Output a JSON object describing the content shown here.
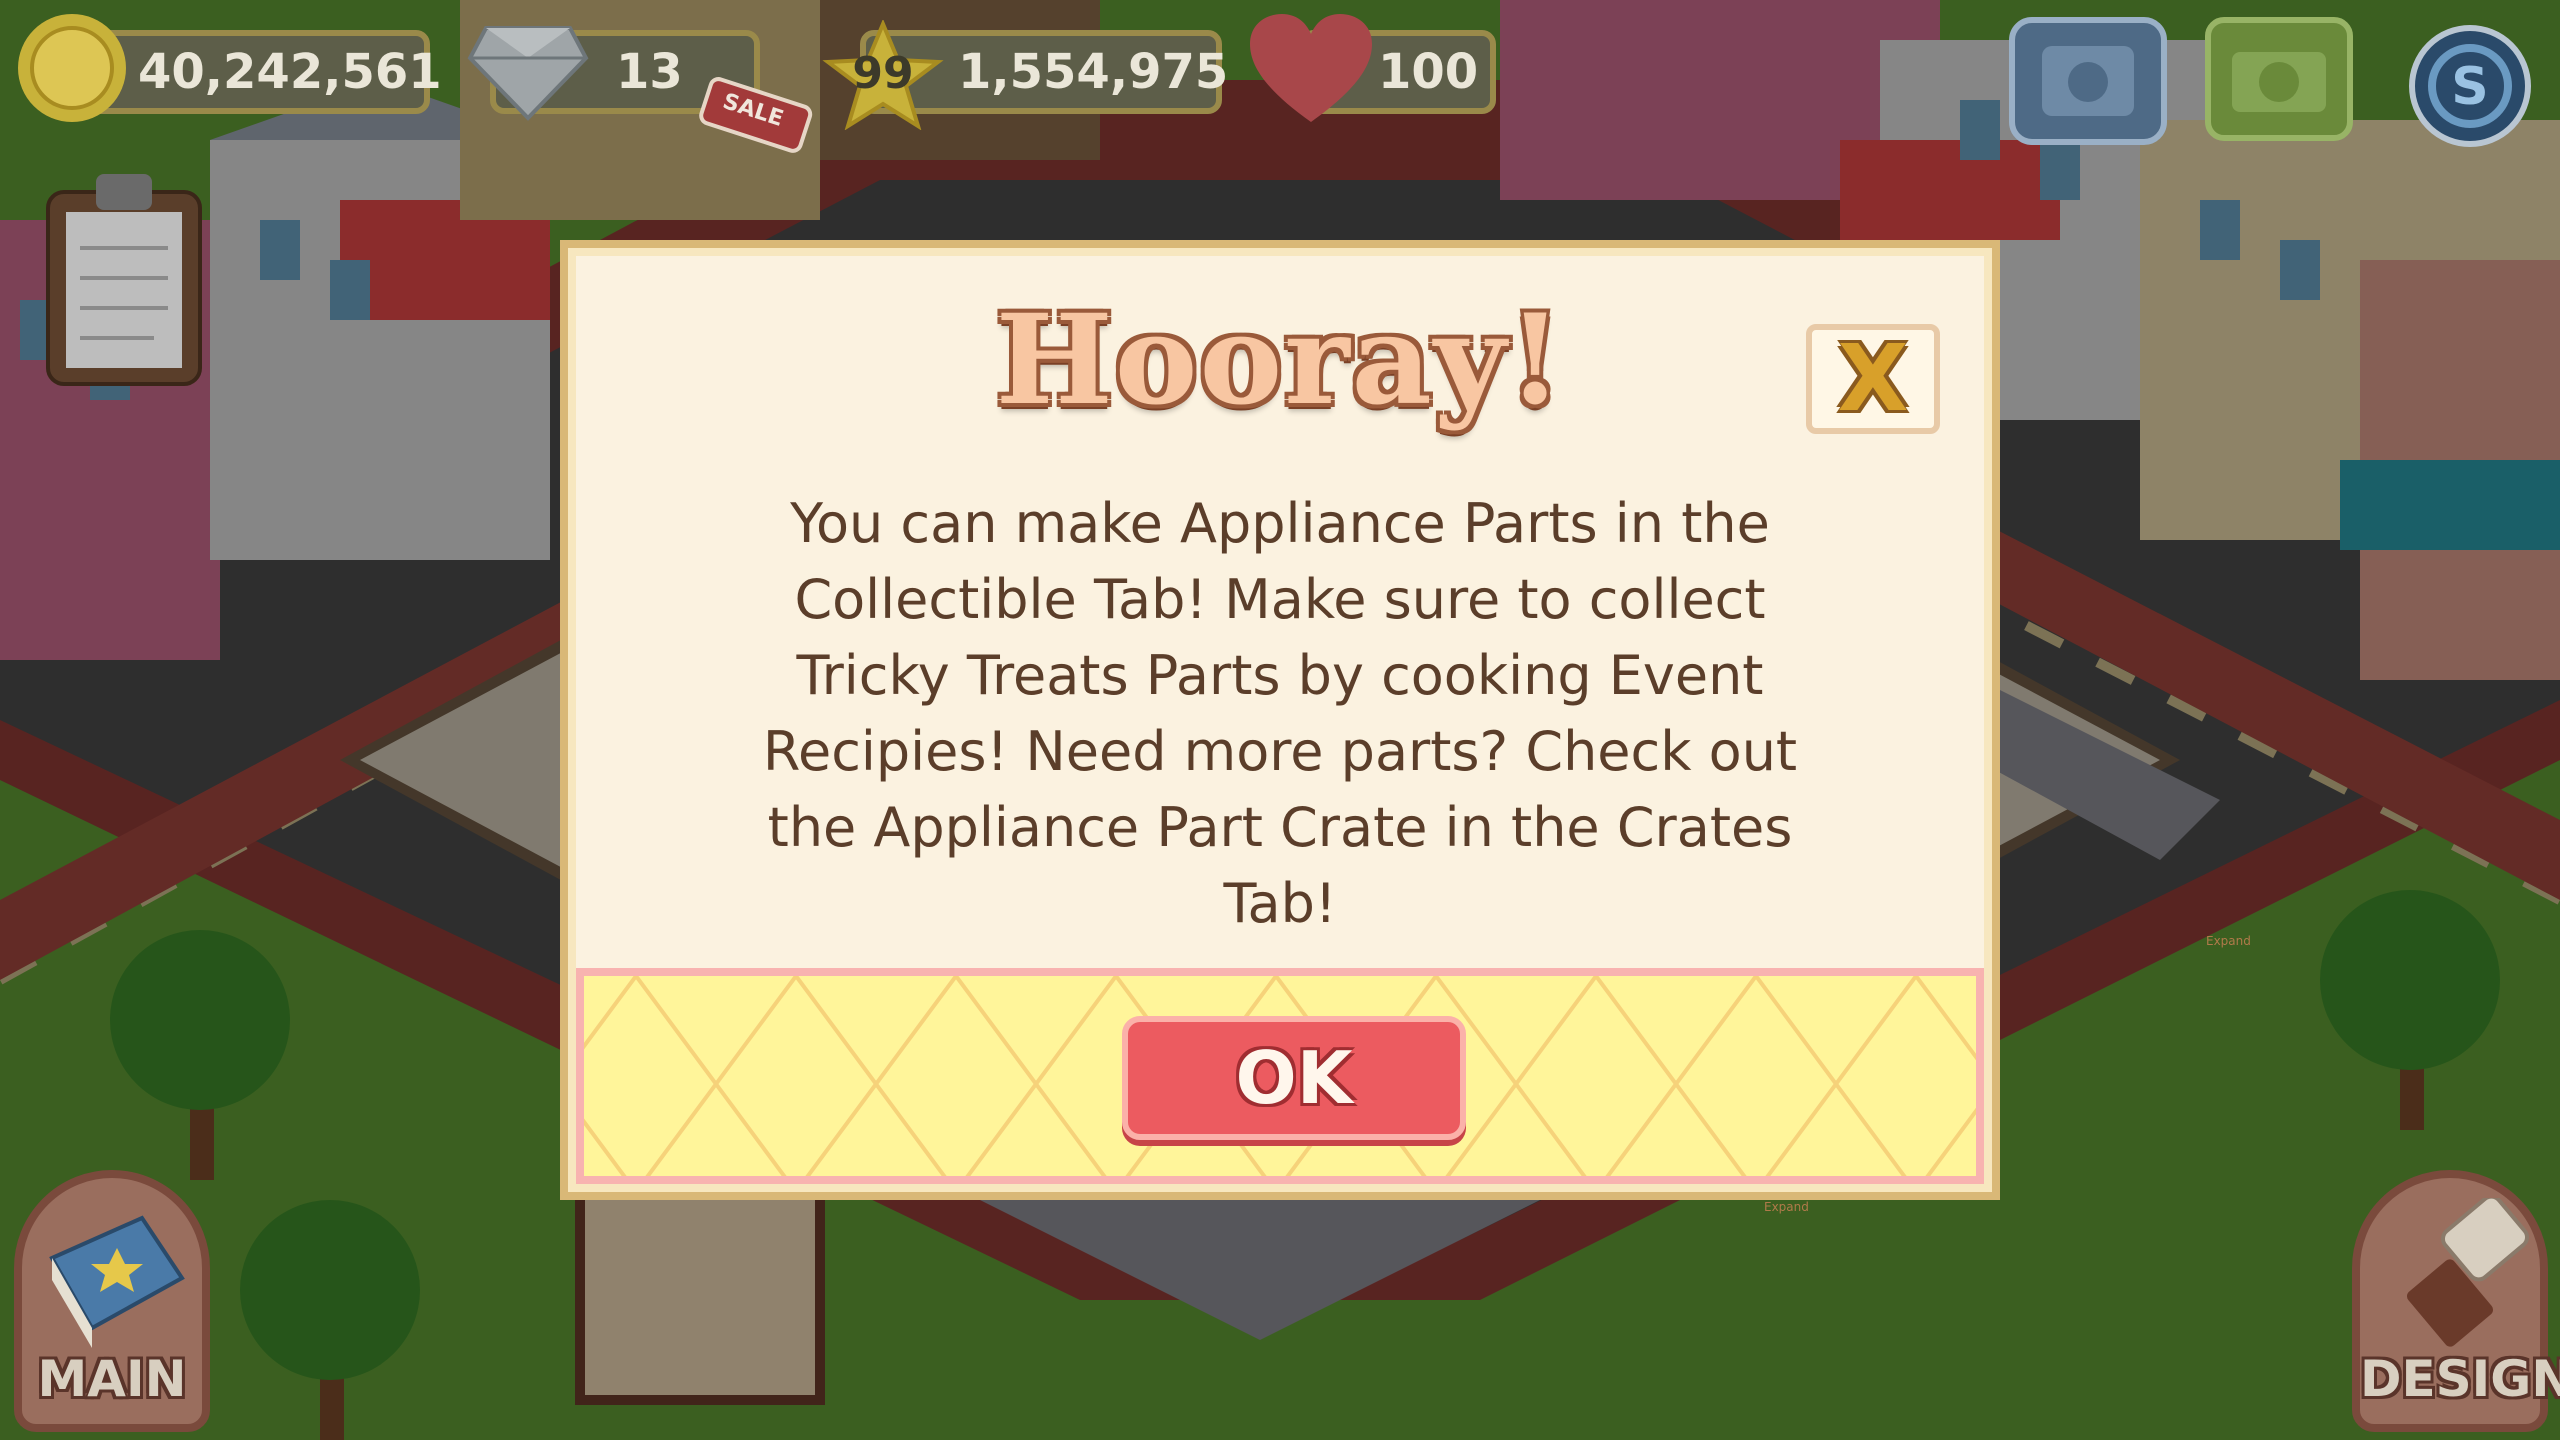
{
  "hud": {
    "coins": "40,242,561",
    "gems": "13",
    "level": "99",
    "xp": "1,554,975",
    "hearts": "100",
    "sale_badge": "SALE",
    "icons": [
      "coin-icon",
      "gem-icon",
      "star-icon",
      "heart-icon",
      "phone-icon",
      "camera-icon",
      "currency-icon",
      "clipboard-icon"
    ]
  },
  "dialog": {
    "title": "Hooray!",
    "close_label": "X",
    "message": "You can make Appliance Parts in the Collectible Tab! Make sure to collect Tricky Treats Parts by cooking Event Recipies! Need more parts? Check out the Appliance Part Crate in the Crates Tab!",
    "ok_label": "OK"
  },
  "bottom": {
    "main_label": "MAIN",
    "design_label": "DESIGN",
    "expand_label": "Expand"
  },
  "colors": {
    "dialog_bg": "#fbf2e0",
    "title_fill": "#f8c6a2",
    "ok_button": "#ec5b60",
    "footer_bg": "#fff59a",
    "hud_pill": "#5d5e49"
  }
}
